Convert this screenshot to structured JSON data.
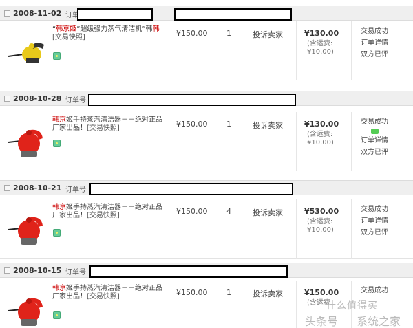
{
  "orders": [
    {
      "date": "2008-11-02",
      "order_label": "订单",
      "title_prefix": "“",
      "title_brand": "韩京姬",
      "title_rest": "”超级强力蒸气清洁机”韩",
      "snapshot": "[交易快照]",
      "unit_price": "¥150.00",
      "quantity": "1",
      "complain": "投诉卖家",
      "total": "¥130.00",
      "shipping_fee": "(含运费:",
      "shipping_amount": "¥10.00)",
      "status": "交易成功",
      "details": "订单详情",
      "rated": "双方已评"
    },
    {
      "date": "2008-10-28",
      "order_label": "订单号",
      "title_prefix": "",
      "title_brand": "韩京",
      "title_rest": "姬手持蒸汽清洁器－－绝对正品厂家出品！",
      "snapshot": "[交易快照]",
      "unit_price": "¥150.00",
      "quantity": "1",
      "complain": "投诉卖家",
      "total": "¥130.00",
      "shipping_fee": "(含运费:",
      "shipping_amount": "¥10.00)",
      "status": "交易成功",
      "details": "订单详情",
      "rated": "双方已评"
    },
    {
      "date": "2008-10-21",
      "order_label": "订单号",
      "title_prefix": "",
      "title_brand": "韩京",
      "title_rest": "姬手持蒸汽清洁器－－绝对正品厂家出品！",
      "snapshot": "[交易快照]",
      "unit_price": "¥150.00",
      "quantity": "4",
      "complain": "投诉卖家",
      "total": "¥530.00",
      "shipping_fee": "(含运费:",
      "shipping_amount": "¥10.00)",
      "status": "交易成功",
      "details": "订单详情",
      "rated": "双方已评"
    },
    {
      "date": "2008-10-15",
      "order_label": "订单号",
      "title_prefix": "",
      "title_brand": "韩京",
      "title_rest": "姬手持蒸汽清洁器－－绝对正品厂家出品！",
      "snapshot": "[交易快照]",
      "unit_price": "¥150.00",
      "quantity": "1",
      "complain": "投诉卖家",
      "total": "¥150.00",
      "shipping_fee": "(含运费",
      "shipping_amount": "",
      "status": "交易成功",
      "details": "",
      "rated": ""
    }
  ],
  "watermark": {
    "line1": "什么值得买",
    "line2a": "头条号",
    "line2b": "系统之家"
  }
}
